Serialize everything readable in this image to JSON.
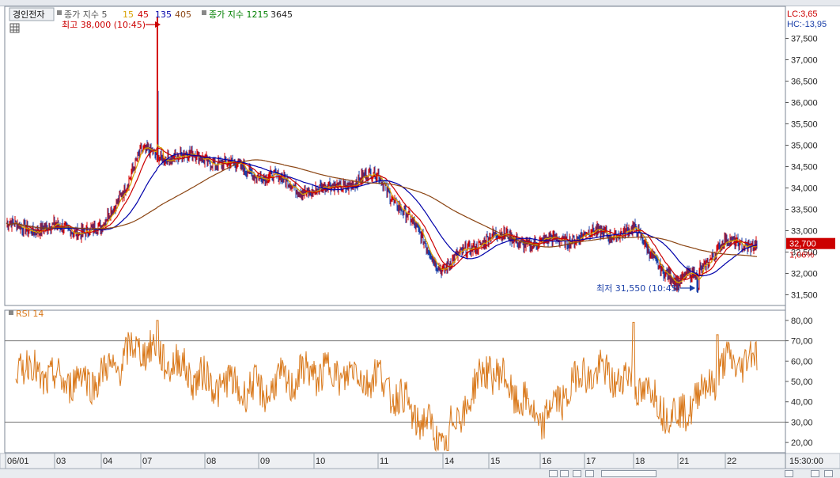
{
  "stock_name": "경인전자",
  "price_legend": [
    {
      "label": "종가 지수 5",
      "color": "#555555"
    },
    {
      "label": "15",
      "color": "#d8a000"
    },
    {
      "label": "45",
      "color": "#cc0000"
    },
    {
      "label": "135",
      "color": "#0000aa"
    },
    {
      "label": "405",
      "color": "#8b4513"
    },
    {
      "label": "종가 지수 1215",
      "color": "#008000"
    },
    {
      "label": "3645",
      "color": "#222222"
    }
  ],
  "lc_label": "LC:3,65",
  "hc_label": "HC:-13,95",
  "high_annotation": "최고 38,000 (10:45)",
  "low_annotation": "최저 31,550 (10:45)",
  "current_price": "32,700",
  "current_change": "1,06%",
  "rsi_label": "RSI 14",
  "time_readout": "15:30:00",
  "colors": {
    "up": "#d40000",
    "down": "#1a3fa8",
    "ma5": "#d8a000",
    "ma15": "#cc0000",
    "ma45": "#0000aa",
    "ma405": "#8b4513",
    "rsi": "#d9781a",
    "price_box": "#cc0000"
  },
  "chart_data": [
    {
      "type": "candlestick",
      "x_ticks": [
        "06/01",
        "03",
        "04",
        "07",
        "08",
        "09",
        "10",
        "11",
        "14",
        "15",
        "16",
        "17",
        "18",
        "21",
        "22"
      ],
      "y_ticks": [
        "37,500",
        "37,000",
        "36,500",
        "36,000",
        "35,500",
        "35,000",
        "34,500",
        "34,000",
        "33,500",
        "33,000",
        "32,500",
        "32,000",
        "31,500"
      ],
      "ylim": [
        31250,
        38250
      ],
      "approx_close_path": [
        {
          "x": "06/01",
          "y": 33100
        },
        {
          "x": "03",
          "y": 33050
        },
        {
          "x": "04",
          "y": 33000
        },
        {
          "x": "07",
          "y": 34800
        },
        {
          "x": "08",
          "y": 34700
        },
        {
          "x": "09",
          "y": 34350
        },
        {
          "x": "10",
          "y": 33900
        },
        {
          "x": "11",
          "y": 34300
        },
        {
          "x": "14",
          "y": 32100
        },
        {
          "x": "15",
          "y": 32900
        },
        {
          "x": "16",
          "y": 32700
        },
        {
          "x": "17",
          "y": 32900
        },
        {
          "x": "18",
          "y": 33000
        },
        {
          "x": "21",
          "y": 31700
        },
        {
          "x": "22",
          "y": 32700
        }
      ],
      "high": 38000,
      "low": 31550,
      "last": 32700
    },
    {
      "type": "line",
      "name": "RSI 14",
      "y_ticks": [
        "80,00",
        "70,00",
        "60,00",
        "50,00",
        "40,00",
        "30,00",
        "20,00"
      ],
      "ylim": [
        15,
        85
      ],
      "reference_lines": [
        70,
        30
      ],
      "approx_path": [
        {
          "x": "06/01",
          "y": 62
        },
        {
          "x": "03",
          "y": 50
        },
        {
          "x": "04",
          "y": 52
        },
        {
          "x": "07",
          "y": 68
        },
        {
          "x": "08",
          "y": 50
        },
        {
          "x": "09",
          "y": 45
        },
        {
          "x": "10",
          "y": 55
        },
        {
          "x": "11",
          "y": 52
        },
        {
          "x": "14",
          "y": 20
        },
        {
          "x": "15",
          "y": 58
        },
        {
          "x": "16",
          "y": 30
        },
        {
          "x": "17",
          "y": 55
        },
        {
          "x": "18",
          "y": 50
        },
        {
          "x": "21",
          "y": 32
        },
        {
          "x": "22",
          "y": 58
        }
      ]
    }
  ]
}
